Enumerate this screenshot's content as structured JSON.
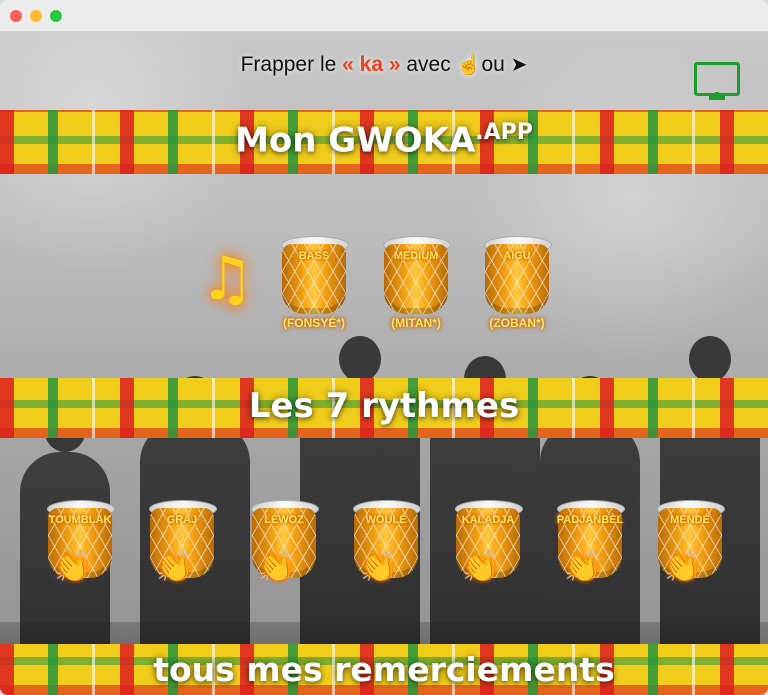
{
  "window": {
    "controls": [
      "close",
      "minimize",
      "zoom"
    ]
  },
  "hint": {
    "prefix": "Frapper le ",
    "ka": "« ka »",
    "middle": " avec ",
    "touch_icon": "☝",
    "or": "ou",
    "cursor_icon": "➤"
  },
  "top_right_icon": "monitor-icon",
  "banners": {
    "app_title": "Mon GWOKA",
    "app_title_suffix": ".APP",
    "rhythms": "Les 7 rythmes",
    "thanks": "tous mes remerciements"
  },
  "music_icon": "♫",
  "drums": [
    {
      "label": "BASS",
      "sub": "(FONSYÉ*)"
    },
    {
      "label": "MEDIUM",
      "sub": "(MITAN*)"
    },
    {
      "label": "AIGU",
      "sub": "(ZOBAN*)"
    }
  ],
  "rhythms": [
    {
      "label": "TOUMBLAK"
    },
    {
      "label": "GRAJ"
    },
    {
      "label": "LÉWOZ"
    },
    {
      "label": "WOULÉ"
    },
    {
      "label": "KALADJA"
    },
    {
      "label": "PADJANBÈL"
    },
    {
      "label": "MENDÉ"
    }
  ],
  "colors": {
    "madras_yellow": "#f0cc1b",
    "madras_red": "#dc1e1e",
    "madras_green": "#28963c",
    "ka_accent": "#e8431d",
    "monitor_green": "#1f9a2b",
    "glow_yellow": "#ffd21a"
  }
}
